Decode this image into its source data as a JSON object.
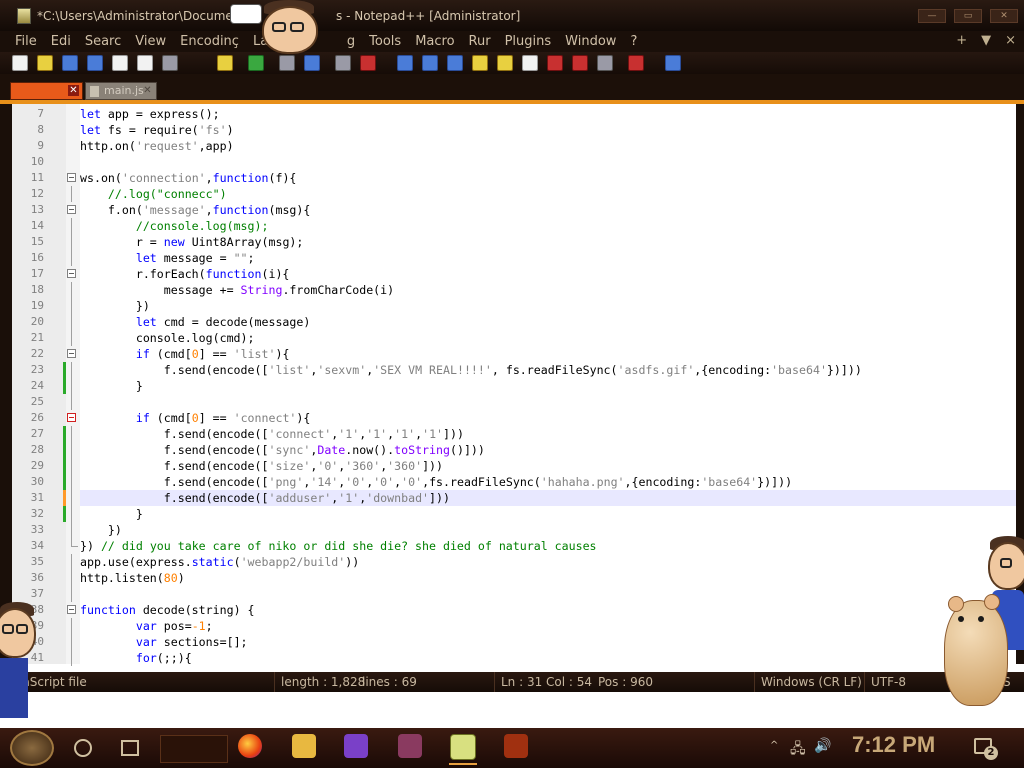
{
  "window": {
    "title": "*C:\\Users\\Administrator\\Documer",
    "title_suffix": "s - Notepad++ [Administrator]"
  },
  "menu": {
    "items": [
      "File",
      "Edi",
      "Searc",
      "View",
      "Encodinç",
      "Langu",
      "g",
      "Tools",
      "Macro",
      "Rur",
      "Plugins",
      "Window",
      "?"
    ],
    "right_plus": "+",
    "right_dropdown": "▼",
    "right_close": "×"
  },
  "tabs": {
    "active_label": "",
    "inactive_label": "main.js",
    "close_glyph": "✕"
  },
  "code_lines": [
    {
      "n": "7",
      "segs": [
        [
          "kw",
          "let"
        ],
        [
          "",
          "app = express();"
        ]
      ]
    },
    {
      "n": "8",
      "segs": [
        [
          "kw",
          "let"
        ],
        [
          "",
          "fs = require("
        ],
        [
          "str",
          "'fs'"
        ],
        [
          "",
          ")"
        ]
      ]
    },
    {
      "n": "9",
      "segs": [
        [
          "",
          "http.on("
        ],
        [
          "str",
          "'request'"
        ],
        [
          "",
          ",app)"
        ]
      ]
    },
    {
      "n": "10",
      "segs": []
    },
    {
      "n": "11",
      "segs": [
        [
          "",
          "ws.on("
        ],
        [
          "str",
          "'connection'"
        ],
        [
          "",
          ","
        ],
        [
          "kw",
          "function"
        ],
        [
          "",
          "(f){"
        ]
      ]
    },
    {
      "n": "12",
      "segs": [
        [
          "",
          "    "
        ],
        [
          "cmt",
          "//.log(\"connecc\")"
        ]
      ]
    },
    {
      "n": "13",
      "segs": [
        [
          "",
          "    f.on("
        ],
        [
          "str",
          "'message'"
        ],
        [
          "",
          ","
        ],
        [
          "kw",
          "function"
        ],
        [
          "",
          "(msg){"
        ]
      ]
    },
    {
      "n": "14",
      "segs": [
        [
          "",
          "        "
        ],
        [
          "cmt",
          "//console.log(msg);"
        ]
      ]
    },
    {
      "n": "15",
      "segs": [
        [
          "",
          "        r = "
        ],
        [
          "kw",
          "new"
        ],
        [
          "",
          " Uint8Array(msg);"
        ]
      ]
    },
    {
      "n": "16",
      "segs": [
        [
          "",
          "        "
        ],
        [
          "kw",
          "let"
        ],
        [
          "",
          " message = "
        ],
        [
          "str",
          "\"\""
        ],
        [
          "",
          ";"
        ]
      ]
    },
    {
      "n": "17",
      "segs": [
        [
          "",
          "        r.forEach("
        ],
        [
          "kw",
          "function"
        ],
        [
          "",
          "(i){"
        ]
      ]
    },
    {
      "n": "18",
      "segs": [
        [
          "",
          "            message += "
        ],
        [
          "fn",
          "String"
        ],
        [
          "",
          ".fromCharCode(i)"
        ]
      ]
    },
    {
      "n": "19",
      "segs": [
        [
          "",
          "        })"
        ]
      ]
    },
    {
      "n": "20",
      "segs": [
        [
          "",
          "        "
        ],
        [
          "kw",
          "let"
        ],
        [
          "",
          " cmd = decode(message)"
        ]
      ]
    },
    {
      "n": "21",
      "segs": [
        [
          "",
          "        console.log(cmd);"
        ]
      ]
    },
    {
      "n": "22",
      "segs": [
        [
          "",
          "        "
        ],
        [
          "kw",
          "if"
        ],
        [
          "",
          " (cmd["
        ],
        [
          "num",
          "0"
        ],
        [
          "",
          "] == "
        ],
        [
          "str",
          "'list'"
        ],
        [
          "",
          "){"
        ]
      ]
    },
    {
      "n": "23",
      "segs": [
        [
          "",
          "            f.send(encode(["
        ],
        [
          "str",
          "'list'"
        ],
        [
          "",
          ","
        ],
        [
          "str",
          "'sexvm'"
        ],
        [
          "",
          ","
        ],
        [
          "str",
          "'SEX VM REAL!!!!'"
        ],
        [
          "",
          ", fs.readFileSync("
        ],
        [
          "str",
          "'asdfs.gif'"
        ],
        [
          "",
          ",{encoding:"
        ],
        [
          "str",
          "'base64'"
        ],
        [
          "",
          "})]))"
        ]
      ]
    },
    {
      "n": "24",
      "segs": [
        [
          "",
          "        }"
        ]
      ]
    },
    {
      "n": "25",
      "segs": []
    },
    {
      "n": "26",
      "segs": [
        [
          "",
          "        "
        ],
        [
          "kw",
          "if"
        ],
        [
          "",
          " (cmd["
        ],
        [
          "num",
          "0"
        ],
        [
          "",
          "] == "
        ],
        [
          "str",
          "'connect'"
        ],
        [
          "",
          "){"
        ]
      ]
    },
    {
      "n": "27",
      "segs": [
        [
          "",
          "            f.send(encode(["
        ],
        [
          "str",
          "'connect'"
        ],
        [
          "",
          ","
        ],
        [
          "str",
          "'1'"
        ],
        [
          "",
          ","
        ],
        [
          "str",
          "'1'"
        ],
        [
          "",
          ","
        ],
        [
          "str",
          "'1'"
        ],
        [
          "",
          ","
        ],
        [
          "str",
          "'1'"
        ],
        [
          "",
          "]))"
        ]
      ]
    },
    {
      "n": "28",
      "segs": [
        [
          "",
          "            f.send(encode(["
        ],
        [
          "str",
          "'sync'"
        ],
        [
          "",
          ","
        ],
        [
          "fn",
          "Date"
        ],
        [
          "",
          ".now()."
        ],
        [
          "fn",
          "toString"
        ],
        [
          "",
          "()]))"
        ]
      ]
    },
    {
      "n": "29",
      "segs": [
        [
          "",
          "            f.send(encode(["
        ],
        [
          "str",
          "'size'"
        ],
        [
          "",
          ","
        ],
        [
          "str",
          "'0'"
        ],
        [
          "",
          ","
        ],
        [
          "str",
          "'360'"
        ],
        [
          "",
          ","
        ],
        [
          "str",
          "'360'"
        ],
        [
          "",
          "]))"
        ]
      ]
    },
    {
      "n": "30",
      "segs": [
        [
          "",
          "            f.send(encode(["
        ],
        [
          "str",
          "'png'"
        ],
        [
          "",
          ","
        ],
        [
          "str",
          "'14'"
        ],
        [
          "",
          ","
        ],
        [
          "str",
          "'0'"
        ],
        [
          "",
          ","
        ],
        [
          "str",
          "'0'"
        ],
        [
          "",
          ","
        ],
        [
          "str",
          "'0'"
        ],
        [
          "",
          ",fs.readFileSync("
        ],
        [
          "str",
          "'hahaha.png'"
        ],
        [
          "",
          ",{encoding:"
        ],
        [
          "str",
          "'base64'"
        ],
        [
          "",
          "})]))"
        ]
      ]
    },
    {
      "n": "31",
      "segs": [
        [
          "",
          "            f.send(encode(["
        ],
        [
          "str",
          "'adduser'"
        ],
        [
          "",
          ","
        ],
        [
          "str",
          "'1'"
        ],
        [
          "",
          ","
        ],
        [
          "str",
          "'downbad'"
        ],
        [
          "",
          "]))"
        ]
      ]
    },
    {
      "n": "32",
      "segs": [
        [
          "",
          "        }"
        ]
      ]
    },
    {
      "n": "33",
      "segs": [
        [
          "",
          "    })"
        ]
      ]
    },
    {
      "n": "34",
      "segs": [
        [
          "",
          "}) "
        ],
        [
          "cmt",
          "// did you take care of niko or did she die? she died of natural causes"
        ]
      ]
    },
    {
      "n": "35",
      "segs": [
        [
          "",
          "app.use(express."
        ],
        [
          "kw",
          "static"
        ],
        [
          "",
          "("
        ],
        [
          "str",
          "'webapp2/build'"
        ],
        [
          "",
          "))"
        ]
      ]
    },
    {
      "n": "36",
      "segs": [
        [
          "",
          "http.listen("
        ],
        [
          "num",
          "80"
        ],
        [
          "",
          ")"
        ]
      ]
    },
    {
      "n": "37",
      "segs": []
    },
    {
      "n": "38",
      "segs": [
        [
          "kw",
          "function"
        ],
        [
          "",
          " decode(string) {"
        ]
      ]
    },
    {
      "n": "39",
      "segs": [
        [
          "",
          "        "
        ],
        [
          "kw",
          "var"
        ],
        [
          "",
          " pos="
        ],
        [
          "num",
          "-1"
        ],
        [
          "",
          ";"
        ]
      ]
    },
    {
      "n": "40",
      "segs": [
        [
          "",
          "        "
        ],
        [
          "kw",
          "var"
        ],
        [
          "",
          " sections=[];"
        ]
      ]
    },
    {
      "n": "41",
      "segs": [
        [
          "",
          "        "
        ],
        [
          "kw",
          "for"
        ],
        [
          "",
          "(;;){"
        ]
      ]
    }
  ],
  "status": {
    "file_type": "avaScript file",
    "length": "length : 1,828",
    "lines": "lines : 69",
    "ln": "Ln : 31",
    "col": "Col : 54",
    "pos": "Pos : 960",
    "eol": "Windows (CR LF)",
    "encoding": "UTF-8",
    "mode": "S"
  },
  "taskbar": {
    "clock": "7:12 PM",
    "notification_count": "2"
  },
  "colors": {
    "keyword": "#0000ff",
    "string": "#808080",
    "number": "#ff8000",
    "comment": "#008000",
    "builtin": "#8000ff",
    "tab_accent": "#e85a1a",
    "change_saved": "#2aaa2a",
    "change_unsaved": "#ff9a2a"
  }
}
